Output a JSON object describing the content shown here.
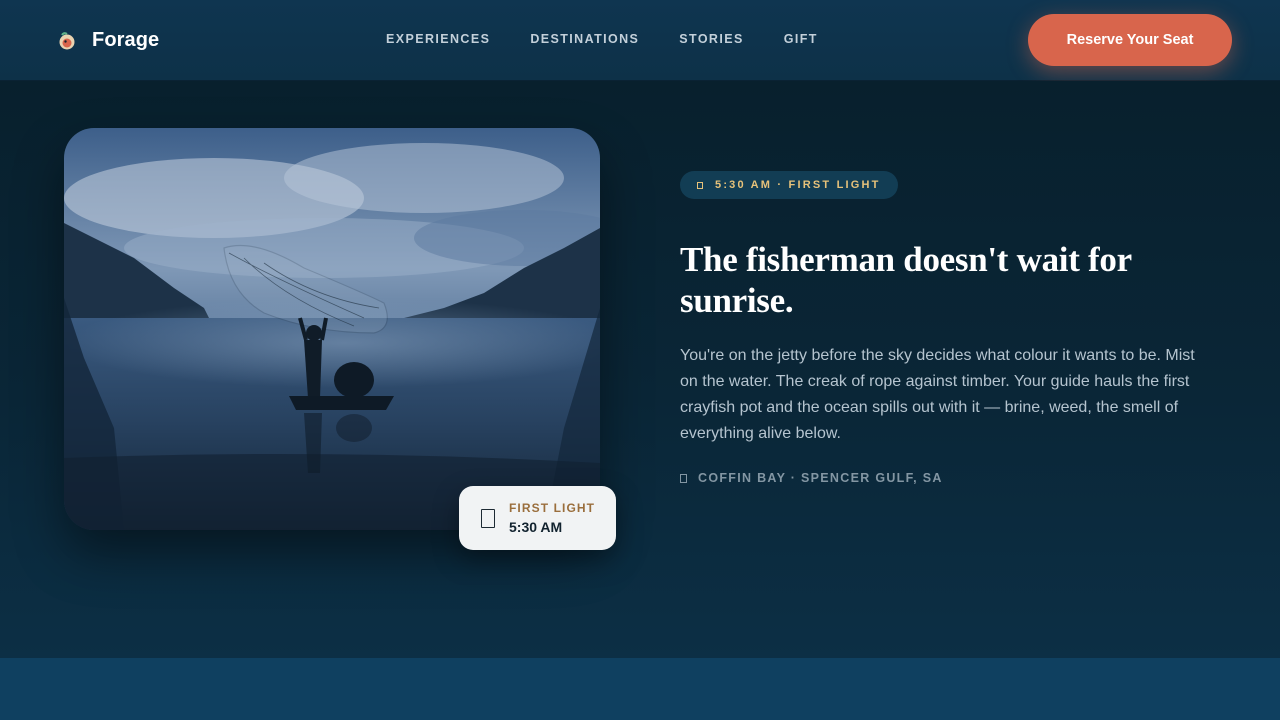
{
  "header": {
    "brand": "Forage",
    "nav": [
      {
        "label": "EXPERIENCES"
      },
      {
        "label": "DESTINATIONS"
      },
      {
        "label": "STORIES"
      },
      {
        "label": "GIFT"
      }
    ],
    "cta_label": "Reserve Your Seat"
  },
  "hero": {
    "pill_text": "5:30 AM · FIRST LIGHT",
    "headline": "The fisherman doesn't wait for sunrise.",
    "body": "You're on the jetty before the sky decides what colour it wants to be. Mist on the water. The creak of rope against timber. Your guide hauls the first crayfish pot and the ocean spills out with it — brine, weed, the smell of everything alive below.",
    "location": "COFFIN BAY · SPENCER GULF, SA",
    "time_card": {
      "label": "FIRST LIGHT",
      "time": "5:30 AM"
    }
  },
  "icons": {
    "logo": "forage-logo-icon",
    "pill": "sunrise-icon",
    "location": "pin-icon",
    "time_card": "lantern-icon"
  },
  "colors": {
    "accent": "#d8654c",
    "gold": "#e7c27a",
    "background": "#0b2434",
    "header": "#0f3550"
  }
}
